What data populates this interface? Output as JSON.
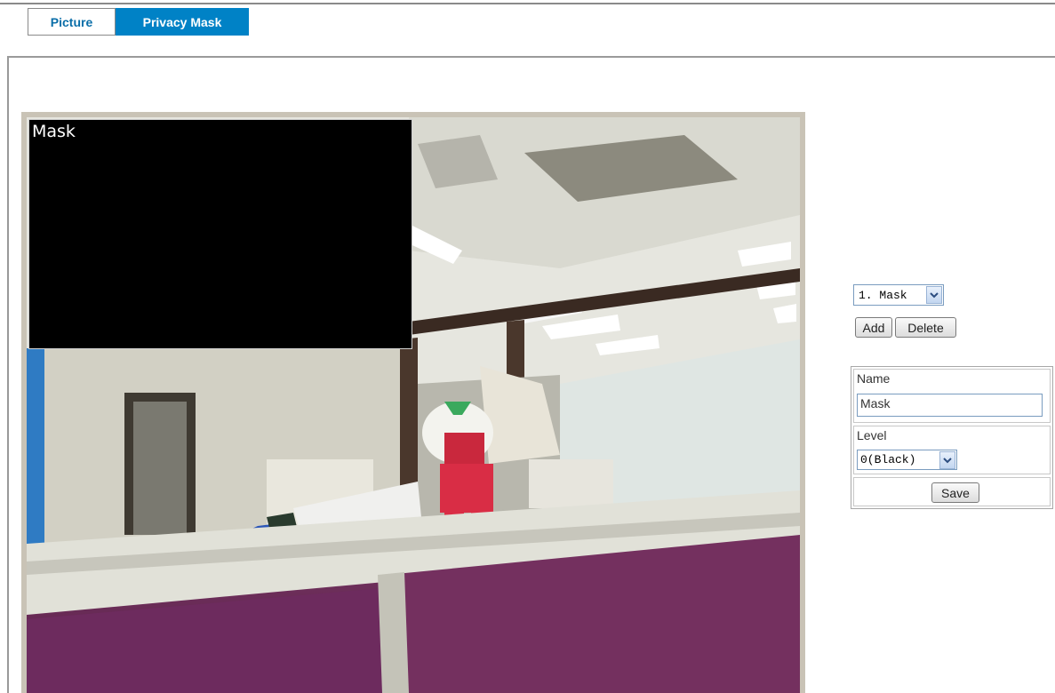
{
  "tabs": [
    {
      "label": "Picture",
      "active": false
    },
    {
      "label": "Privacy Mask",
      "active": true
    }
  ],
  "colors": {
    "accent": "#0082c6",
    "tab_link": "#0a6ea8",
    "mask_fill": "#000000"
  },
  "preview": {
    "mask_overlay_label": "Mask"
  },
  "mask_list": {
    "selected": "1. Mask",
    "add_label": "Add",
    "delete_label": "Delete"
  },
  "properties": {
    "name_label": "Name",
    "name_value": "Mask",
    "level_label": "Level",
    "level_value": "0(Black)",
    "save_label": "Save"
  },
  "icons": {
    "dropdown": "chevron-down-icon"
  }
}
